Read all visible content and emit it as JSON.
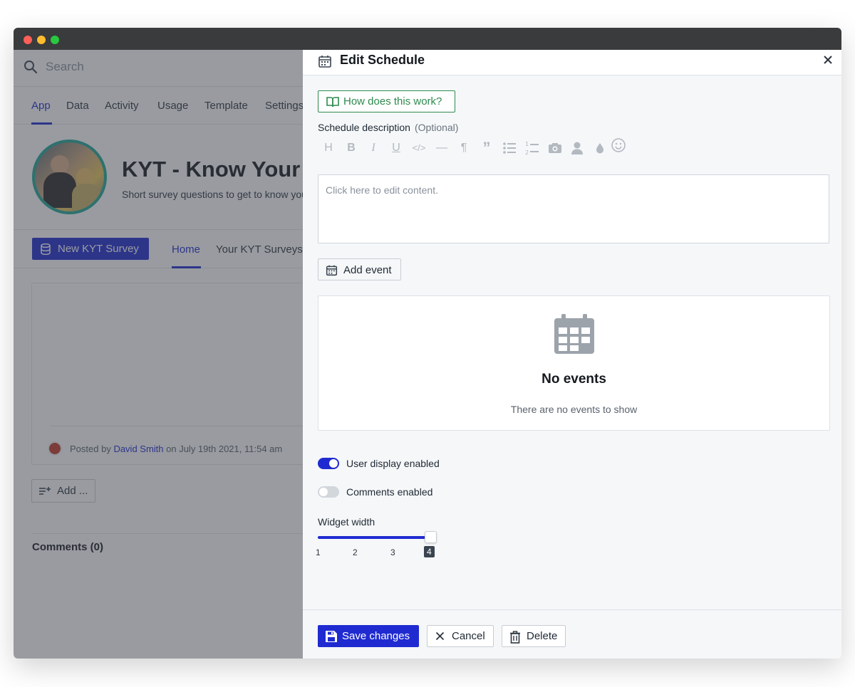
{
  "left": {
    "search_placeholder": "Search",
    "tabs": [
      {
        "label": "App",
        "active": true
      },
      {
        "label": "Data"
      },
      {
        "label": "Activity"
      },
      {
        "label": "Usage"
      },
      {
        "label": "Template"
      },
      {
        "label": "Settings"
      }
    ],
    "app_title": "KYT - Know Your Team",
    "app_subtitle": "Short survey questions to get to know your team",
    "new_button": "New KYT Survey",
    "subtabs": [
      {
        "label": "Home",
        "active": true
      },
      {
        "label": "Your KYT Surveys"
      }
    ],
    "post": {
      "prefix": "Posted by ",
      "author": "David Smith",
      "suffix": " on July 19th 2021, 11:54 am"
    },
    "add_button": "Add ...",
    "comments_heading": "Comments (0)"
  },
  "panel": {
    "title": "Edit Schedule",
    "help_button": "How does this work?",
    "description_label": "Schedule description",
    "description_optional": "(Optional)",
    "editor_placeholder": "Click here to edit content.",
    "toolbar_icons": [
      "heading-icon",
      "bold-icon",
      "italic-icon",
      "underline-icon",
      "code-icon",
      "divider-icon",
      "paragraph-icon",
      "quote-icon",
      "bullet-list-icon",
      "numbered-list-icon",
      "image-icon",
      "mention-icon",
      "color-icon",
      "emoji-icon"
    ],
    "add_event_button": "Add event",
    "empty_title": "No events",
    "empty_subtitle": "There are no events to show",
    "user_display": {
      "label": "User display enabled",
      "enabled": true
    },
    "comments": {
      "label": "Comments enabled",
      "enabled": false
    },
    "widget_width": {
      "label": "Widget width",
      "ticks": [
        "1",
        "2",
        "3",
        "4"
      ],
      "value": 4
    },
    "save_button": "Save changes",
    "cancel_button": "Cancel",
    "delete_button": "Delete"
  },
  "colors": {
    "accent": "#1f2bd0",
    "help_green": "#2e8a4f",
    "avatar_ring": "#20a89a"
  }
}
